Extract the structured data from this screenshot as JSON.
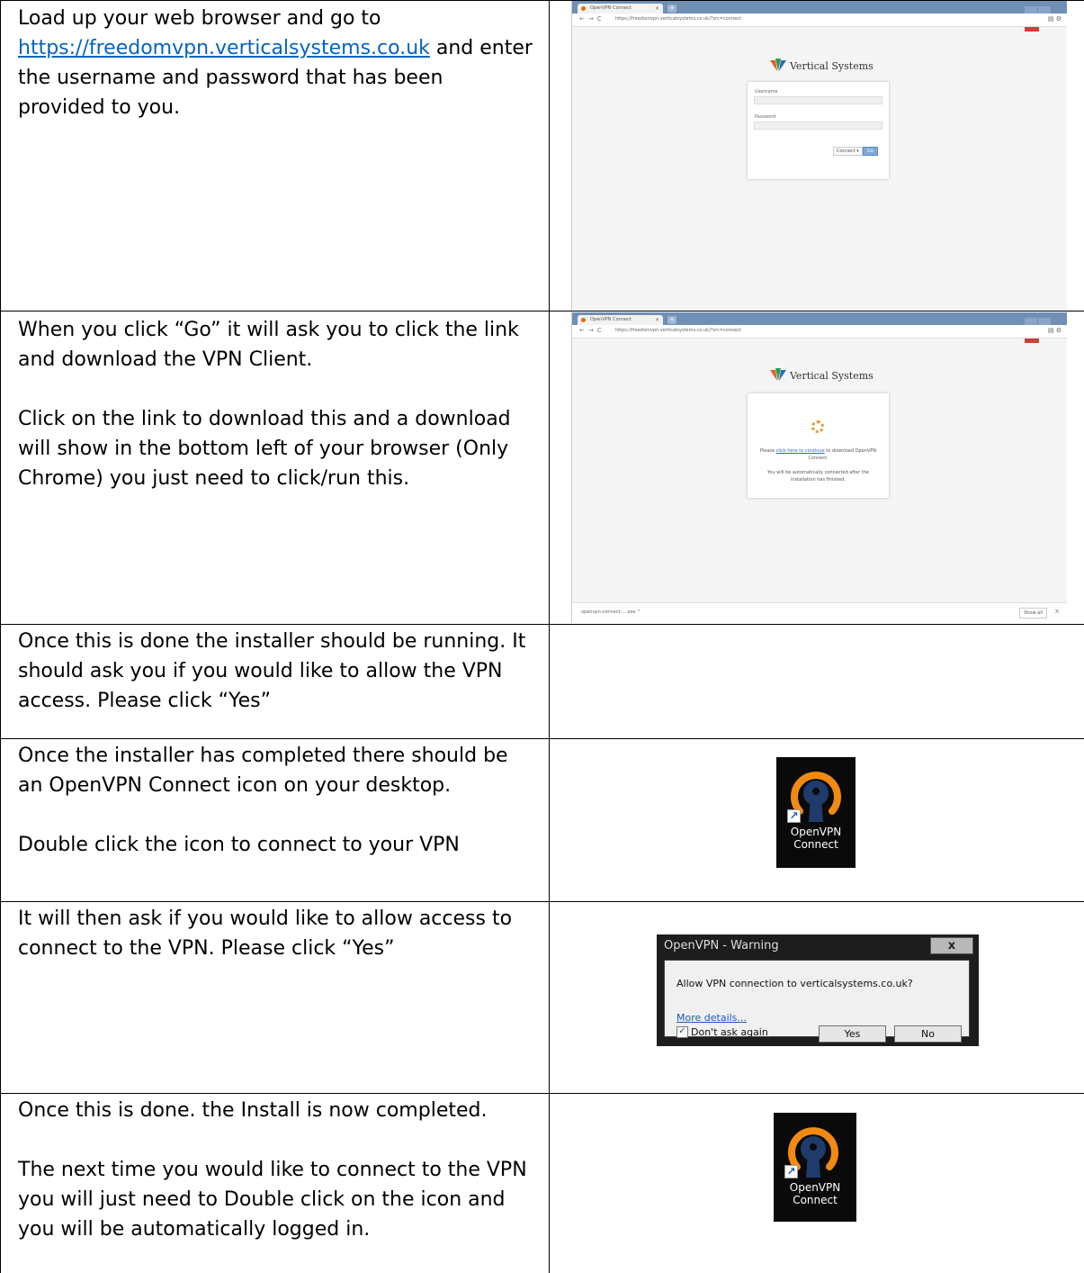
{
  "rows": [
    {
      "text_before_link": "Load up your web browser and go to ",
      "link": "https://freedomvpn.verticalsystems.co.uk",
      "text_after_link": " and enter the username and password that has been provided to you."
    },
    {
      "para1": "When you click “Go” it will ask you to click the link and download the VPN Client.",
      "para2": "Click on the link to download this and a download will show in the bottom left of your browser (Only Chrome) you just need to click/run this."
    },
    {
      "para1": "Once this is done the installer should be running. It should ask you if you would like to allow the VPN access. Please click “Yes”"
    },
    {
      "para1": "Once the installer has completed there should be an OpenVPN Connect icon on your desktop.",
      "para2": "Double click the icon to connect to your VPN"
    },
    {
      "para1": "It will then ask if you would like to allow access to connect to the VPN. Please click “Yes”"
    },
    {
      "para1": "Once this is done. the Install is now completed.",
      "para2": "The next time you would like to connect to the VPN you will just need to Double click on the icon and you will be automatically logged in."
    }
  ],
  "browser": {
    "tab_title": "OpenVPN Connect",
    "url": "https://freedomvpn.verticalsystems.co.uk/?src=connect",
    "brand": "Vertical Systems",
    "username_label": "Username",
    "password_label": "Password",
    "connect_label": "Connect ▾",
    "go_label": "Go",
    "msg_prefix": "Please ",
    "msg_link": "click here to continue",
    "msg_suffix": " to download OpenVPN Connect.",
    "msg_auto": "You will be automatically connected after the installation has finished.",
    "download_file": "openvpn-connect-....exe ^",
    "show_all": "Show all"
  },
  "desktop_icon": {
    "label_line1": "OpenVPN",
    "label_line2": "Connect"
  },
  "dialog": {
    "title": "OpenVPN - Warning",
    "close": "x",
    "question": "Allow VPN connection to verticalsystems.co.uk?",
    "more_details": "More details...",
    "dont_ask": "Don't ask again",
    "yes": "Yes",
    "no": "No"
  },
  "colors": {
    "link": "#0563c1",
    "openvpn_orange": "#f28a12",
    "openvpn_blue": "#1f3b6b"
  }
}
